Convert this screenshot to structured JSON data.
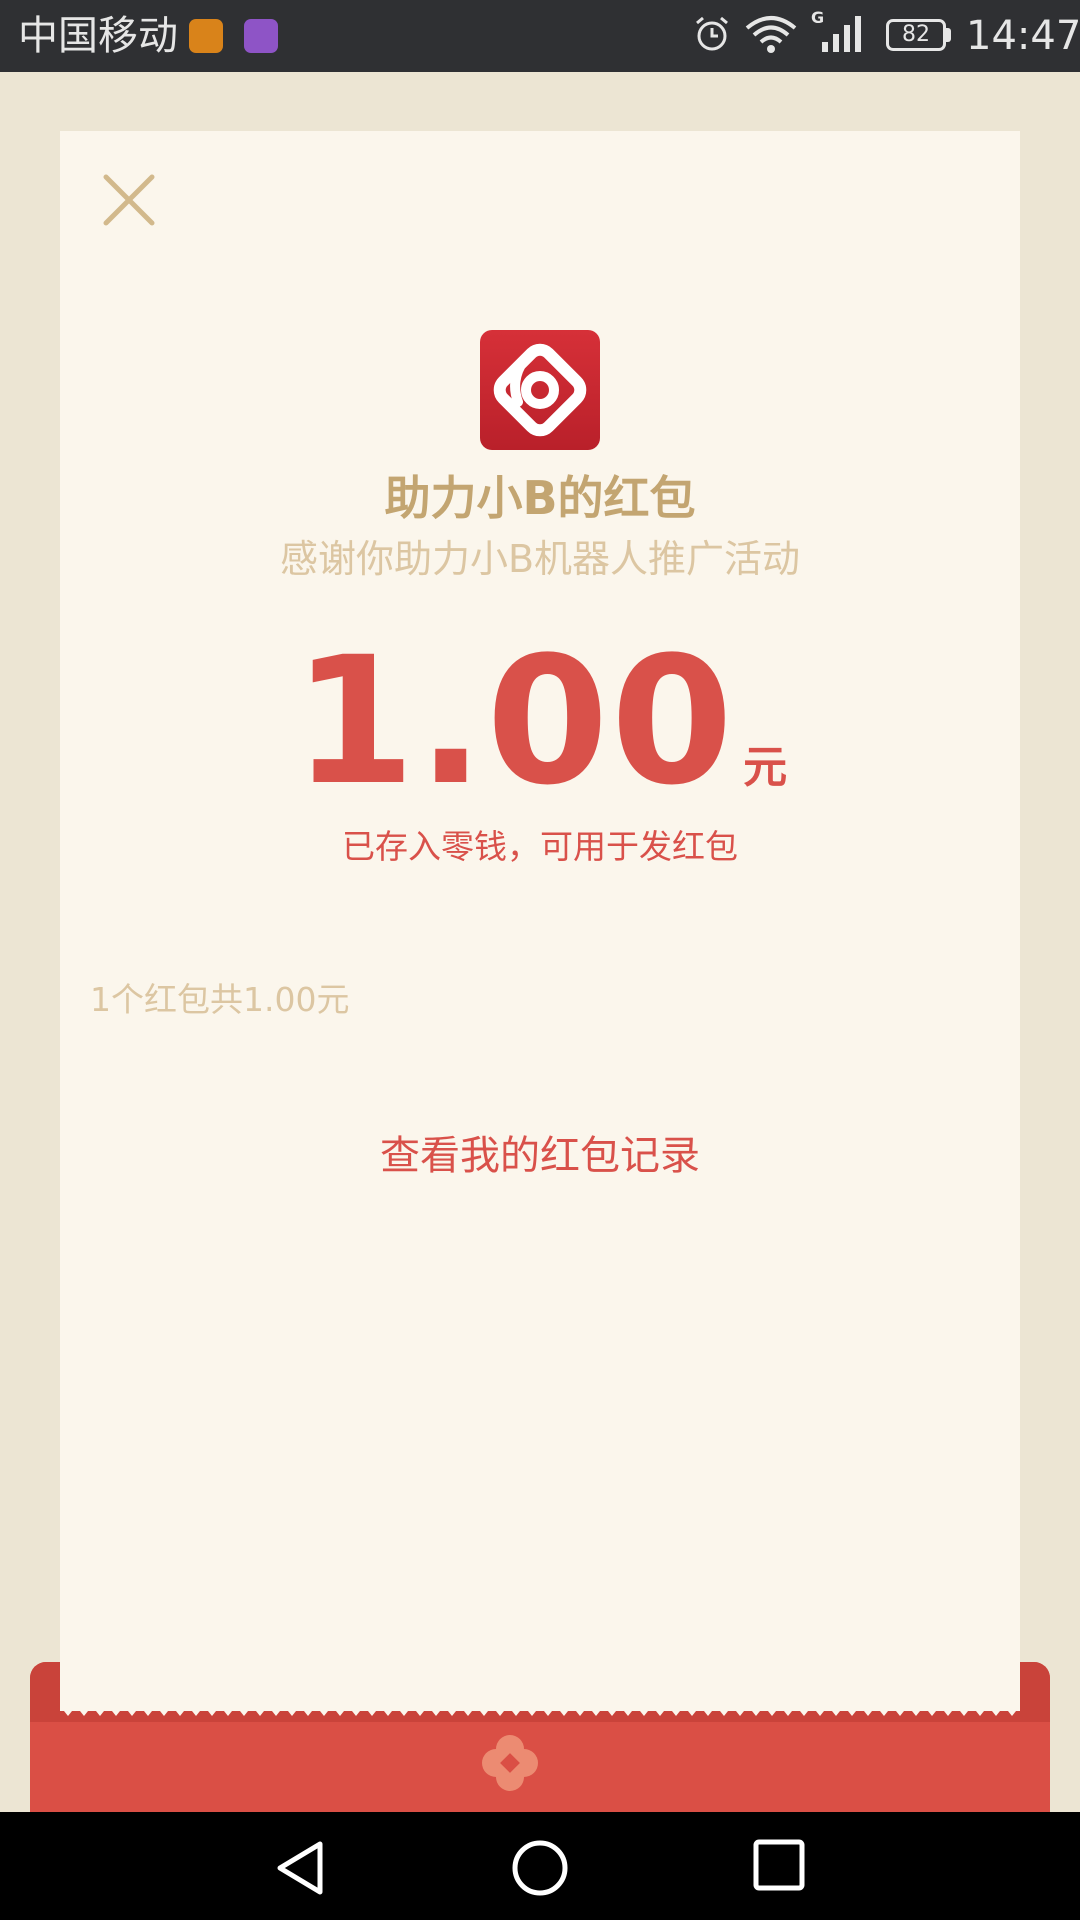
{
  "status_bar": {
    "carrier": "中国移动",
    "network_type": "G",
    "battery": "82",
    "time": "14:47"
  },
  "icons": {
    "close": "close-icon",
    "logo": "app-logo-icon",
    "emblem": "envelope-emblem-icon"
  },
  "red_packet": {
    "title": "助力小B的红包",
    "subtitle": "感谢你助力小B机器人推广活动",
    "amount": "1.00",
    "unit": "元",
    "note": "已存入零钱，可用于发红包",
    "summary": "1个红包共1.00元",
    "record_link": "查看我的红包记录"
  },
  "colors": {
    "accent_red": "#d9514a",
    "gold": "#c3a571",
    "paper": "#fbf6ec",
    "background": "#ece5d3"
  }
}
